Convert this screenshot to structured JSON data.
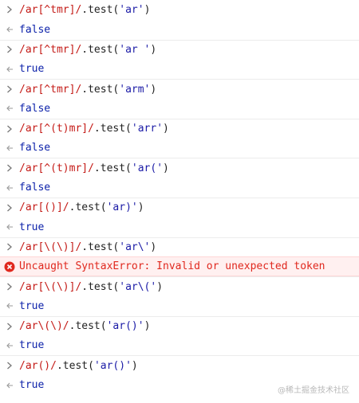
{
  "colors": {
    "regex": "#c41a16",
    "string": "#1a1aa6",
    "boolean": "#0d22aa",
    "error_text": "#e0281e",
    "error_bg": "#fff0f0"
  },
  "entries": [
    {
      "type": "command",
      "regex": "/ar[^tmr]/",
      "method": ".test(",
      "arg": "'ar'",
      "close": ")"
    },
    {
      "type": "result",
      "value": "false"
    },
    {
      "type": "command",
      "regex": "/ar[^tmr]/",
      "method": ".test(",
      "arg": "'ar '",
      "close": ")"
    },
    {
      "type": "result",
      "value": "true"
    },
    {
      "type": "command",
      "regex": "/ar[^tmr]/",
      "method": ".test(",
      "arg": "'arm'",
      "close": ")"
    },
    {
      "type": "result",
      "value": "false"
    },
    {
      "type": "command",
      "regex": "/ar[^(t)mr]/",
      "method": ".test(",
      "arg": "'arr'",
      "close": ")"
    },
    {
      "type": "result",
      "value": "false"
    },
    {
      "type": "command",
      "regex": "/ar[^(t)mr]/",
      "method": ".test(",
      "arg": "'ar('",
      "close": ")"
    },
    {
      "type": "result",
      "value": "false"
    },
    {
      "type": "command",
      "regex": "/ar[()]/",
      "method": ".test(",
      "arg": "'ar)'",
      "close": ")"
    },
    {
      "type": "result",
      "value": "true"
    },
    {
      "type": "command",
      "regex": "/ar[\\(\\)]/",
      "method": ".test(",
      "arg": "'ar\\'",
      "close": ")"
    },
    {
      "type": "error",
      "value": "Uncaught SyntaxError: Invalid or unexpected token"
    },
    {
      "type": "command",
      "regex": "/ar[\\(\\)]/",
      "method": ".test(",
      "arg": "'ar\\('",
      "close": ")"
    },
    {
      "type": "result",
      "value": "true"
    },
    {
      "type": "command",
      "regex": "/ar\\(\\)/",
      "method": ".test(",
      "arg": "'ar()'",
      "close": ")"
    },
    {
      "type": "result",
      "value": "true"
    },
    {
      "type": "command",
      "regex": "/ar()/",
      "method": ".test(",
      "arg": "'ar()'",
      "close": ")"
    },
    {
      "type": "result",
      "value": "true"
    }
  ],
  "watermark": "@稀土掘金技术社区"
}
